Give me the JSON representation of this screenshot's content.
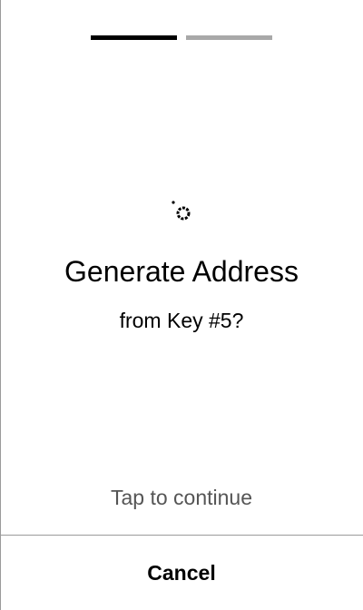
{
  "colors": {
    "progress_active": "#000000",
    "progress_inactive": "#a8a8a8",
    "text_primary": "#000000",
    "text_secondary": "#555555",
    "divider": "#9a9a9a"
  },
  "progress": {
    "total_steps": 2,
    "current_step": 1
  },
  "loading": {
    "icon": "spinner-icon"
  },
  "main": {
    "title": "Generate Address",
    "subtitle": "from Key #5?",
    "tap_hint": "Tap to continue"
  },
  "footer": {
    "cancel_label": "Cancel"
  }
}
